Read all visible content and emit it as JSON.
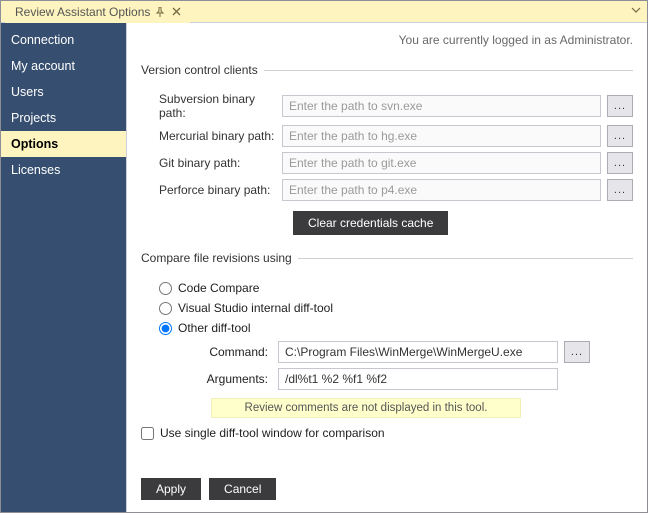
{
  "window": {
    "title": "Review Assistant Options"
  },
  "status": {
    "text": "You are currently logged in as Administrator."
  },
  "sidebar": {
    "items": [
      {
        "label": "Connection"
      },
      {
        "label": "My account"
      },
      {
        "label": "Users"
      },
      {
        "label": "Projects"
      },
      {
        "label": "Options"
      },
      {
        "label": "Licenses"
      }
    ],
    "selected_index": 4
  },
  "vcs": {
    "legend": "Version control clients",
    "rows": [
      {
        "label": "Subversion binary path:",
        "placeholder": "Enter the path to svn.exe",
        "value": ""
      },
      {
        "label": "Mercurial binary path:",
        "placeholder": "Enter the path to hg.exe",
        "value": ""
      },
      {
        "label": "Git binary path:",
        "placeholder": "Enter the path to git.exe",
        "value": ""
      },
      {
        "label": "Perforce binary path:",
        "placeholder": "Enter the path to p4.exe",
        "value": ""
      }
    ],
    "clear_label": "Clear credentials cache",
    "browse_label": "..."
  },
  "compare": {
    "legend": "Compare file revisions using",
    "radios": [
      {
        "label": "Code Compare"
      },
      {
        "label": "Visual Studio internal diff-tool"
      },
      {
        "label": "Other diff-tool"
      }
    ],
    "selected_radio": 2,
    "command_label": "Command:",
    "command_value": "C:\\Program Files\\WinMerge\\WinMergeU.exe",
    "arguments_label": "Arguments:",
    "arguments_value": "/dl%t1 %2 %f1 %f2",
    "note": "Review comments are not displayed in this tool.",
    "single_window_label": "Use single diff-tool window for comparison",
    "single_window_checked": false
  },
  "footer": {
    "apply": "Apply",
    "cancel": "Cancel"
  }
}
